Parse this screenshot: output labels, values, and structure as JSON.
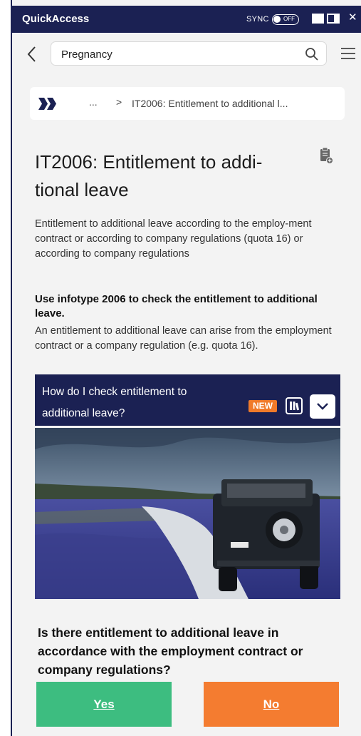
{
  "app": {
    "title": "QuickAccess",
    "sync_label": "SYNC",
    "sync_state": "OFF"
  },
  "search": {
    "value": "Pregnancy"
  },
  "breadcrumb": {
    "ellipsis": "...",
    "separator": ">",
    "current": "IT2006: Entitlement to additional l..."
  },
  "article": {
    "title": "IT2006: Entitlement to addi-tional leave",
    "description": "Entitlement to additional leave according to the employ-ment contract or according to company regulations (quota 16) or according to company regulations",
    "info_heading": "Use infotype 2006 to check the entitlement to additional leave.",
    "info_body": "An entitlement to additional leave can arise from the employment contract or a company regulation (e.g. quota 16).",
    "question_bar": {
      "text": "How do I check entitlement to additional leave?",
      "badge": "NEW"
    },
    "question": "Is there entitlement to additional leave in accordance with the employment contract or company regulations?",
    "yes_label": "Yes",
    "no_label": "No"
  },
  "colors": {
    "navy": "#1b2153",
    "accent_orange": "#f47c30",
    "yes_green": "#3dbd80"
  }
}
